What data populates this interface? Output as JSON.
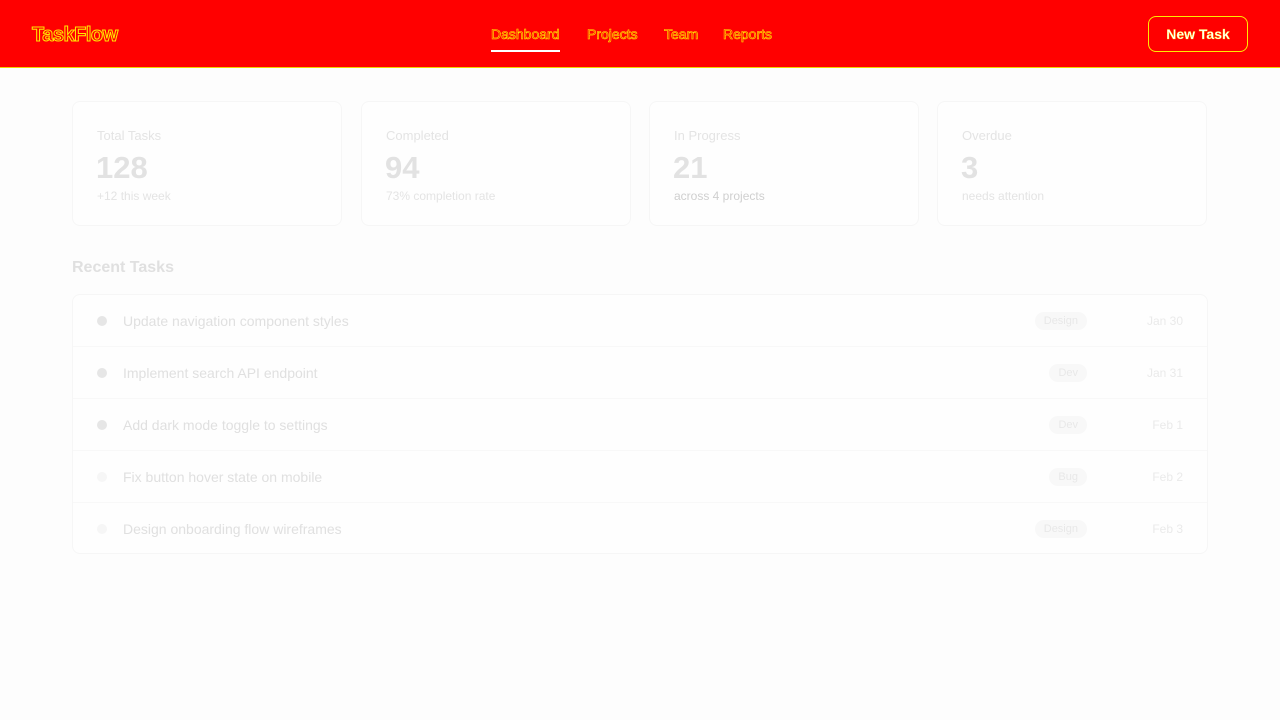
{
  "app": {
    "name": "TaskFlow"
  },
  "nav": {
    "items": [
      {
        "label": "Dashboard",
        "active": true
      },
      {
        "label": "Projects",
        "active": false
      },
      {
        "label": "Team",
        "active": false
      },
      {
        "label": "Reports",
        "active": false
      }
    ]
  },
  "header": {
    "new_task_label": "New Task"
  },
  "stats": [
    {
      "label": "Total Tasks",
      "value": "128",
      "sub": "+12 this week"
    },
    {
      "label": "Completed",
      "value": "94",
      "sub": "73% completion rate"
    },
    {
      "label": "In Progress",
      "value": "21",
      "sub": "across 4 projects"
    },
    {
      "label": "Overdue",
      "value": "3",
      "sub": "needs attention"
    }
  ],
  "recent": {
    "title": "Recent Tasks",
    "tasks": [
      {
        "title": "Update navigation component styles",
        "tag": "Design",
        "date": "Jan 30"
      },
      {
        "title": "Implement search API endpoint",
        "tag": "Dev",
        "date": "Jan 31"
      },
      {
        "title": "Add dark mode toggle to settings",
        "tag": "Dev",
        "date": "Feb 1"
      },
      {
        "title": "Fix button hover state on mobile",
        "tag": "Bug",
        "date": "Feb 2"
      },
      {
        "title": "Design onboarding flow wireframes",
        "tag": "Design",
        "date": "Feb 3"
      }
    ]
  },
  "colors": {
    "header_bg": "#ff0000",
    "header_accent": "#ffea00",
    "page_bg": "#fdfdfd"
  }
}
